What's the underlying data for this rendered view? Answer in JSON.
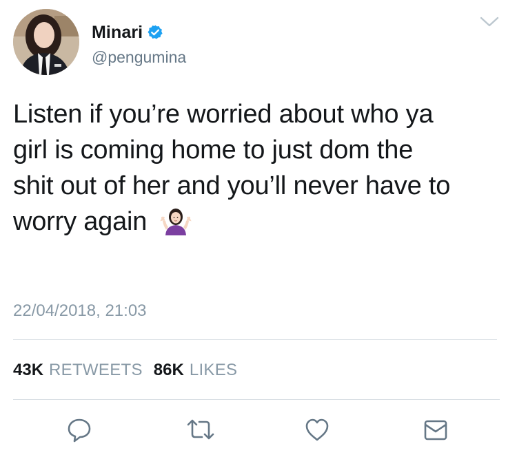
{
  "user": {
    "display_name": "Minari",
    "handle": "@pengumina",
    "verified": true
  },
  "tweet": {
    "text_lines": [
      "Listen if you’re worried about who ya",
      "girl is coming home to just dom the",
      "shit out of her and you’ll never have to",
      "worry again"
    ],
    "emoji": "person-shrugging",
    "timestamp": "22/04/2018, 21:03"
  },
  "stats": {
    "retweets_count": "43K",
    "retweets_label": "RETWEETS",
    "likes_count": "86K",
    "likes_label": "LIKES"
  },
  "actions": [
    "reply-icon",
    "retweet-icon",
    "like-icon",
    "message-icon"
  ],
  "colors": {
    "text": "#14171a",
    "secondary": "#657786",
    "muted": "#8899a6",
    "verified": "#1da1f2",
    "icon": "#657786"
  }
}
